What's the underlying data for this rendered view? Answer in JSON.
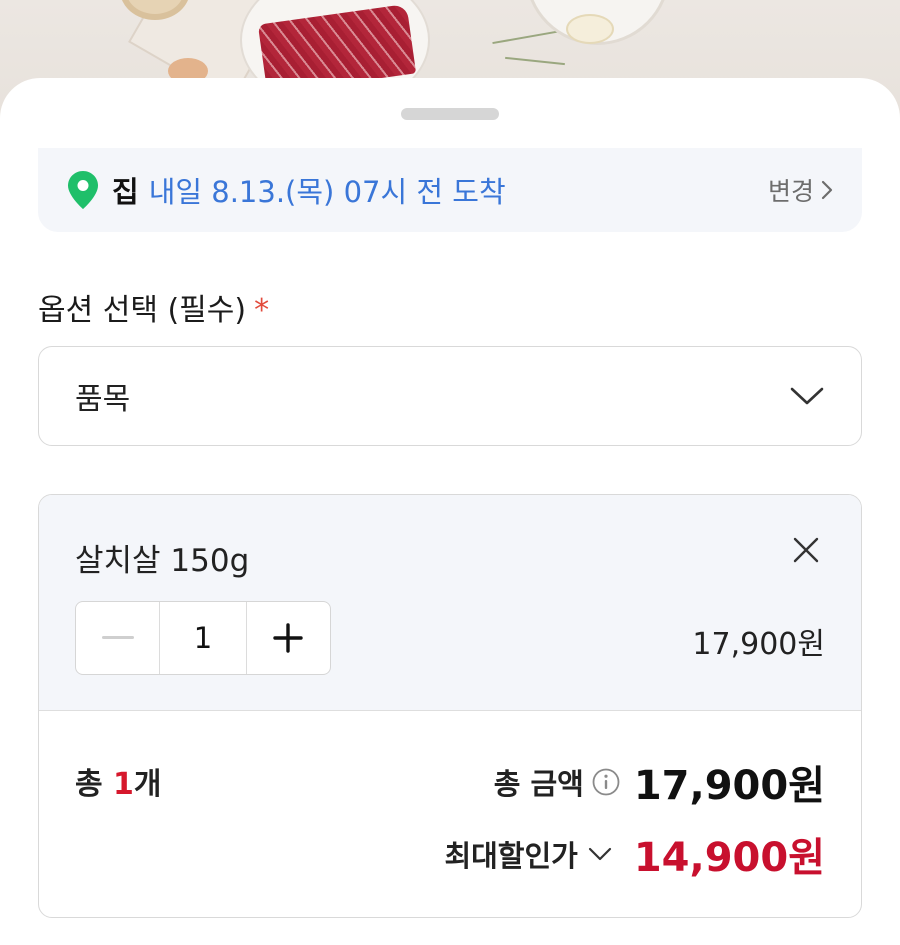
{
  "delivery": {
    "destination": "집",
    "eta": "내일 8.13.(목) 07시 전 도착",
    "change_label": "변경"
  },
  "option": {
    "title": "옵션 선택 (필수)",
    "required_mark": "*",
    "select_value": "품목"
  },
  "item": {
    "name": "살치살 150g",
    "quantity": "1",
    "price": "17,900원"
  },
  "summary": {
    "count_prefix": "총 ",
    "count_value": "1",
    "count_suffix": "개",
    "total_label": "총 금액",
    "total_amount": "17,900원",
    "discount_label": "최대할인가",
    "discount_amount": "14,900원"
  },
  "colors": {
    "accent_blue": "#3a76d8",
    "location_green": "#1fbf6a",
    "discount_red": "#c8102e",
    "required_red": "#e24a3b"
  },
  "icons": {
    "location": "location-pin-icon",
    "change": "chevron-right-icon",
    "select": "chevron-down-icon",
    "remove": "close-icon",
    "minus": "minus-icon",
    "plus": "plus-icon",
    "info": "info-icon",
    "discount_toggle": "chevron-down-icon"
  }
}
